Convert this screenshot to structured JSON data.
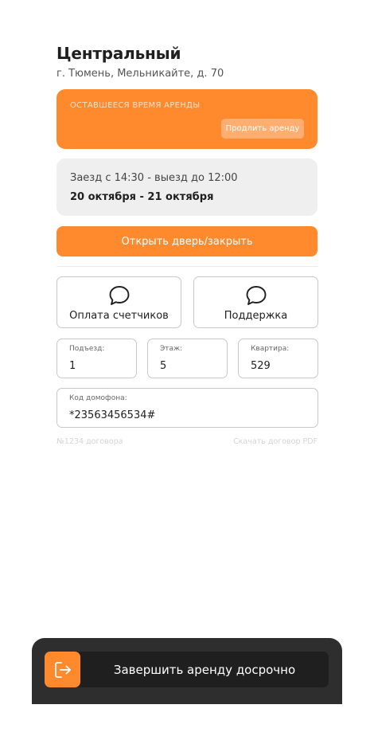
{
  "header": {
    "title": "Центральный",
    "address": "г. Тюмень, Мельникайте, д. 70"
  },
  "rent": {
    "caption": "ОСТАВШЕЕСЯ ВРЕМЯ АРЕНДЫ",
    "extend_label": "Продлить аренду"
  },
  "dates": {
    "checkin_checkout": "Заезд с 14:30 - выезд до 12:00",
    "range": "20 октября - 21 октября"
  },
  "door_button_label": "Открыть дверь/закрыть",
  "actions": {
    "meters": {
      "label": "Оплата счетчиков",
      "icon": "chat-bubble-icon"
    },
    "support": {
      "label": "Поддержка",
      "icon": "chat-bubble-icon"
    }
  },
  "fields": {
    "entrance": {
      "label": "Подъезд:",
      "value": "1"
    },
    "floor": {
      "label": "Этаж:",
      "value": "5"
    },
    "apartment": {
      "label": "Квартира:",
      "value": "529"
    },
    "intercom": {
      "label": "Код домофона:",
      "value": "*23563456534#"
    }
  },
  "footer": {
    "contract_number": "№1234 договора",
    "download_pdf": "Скачать договор PDF"
  },
  "end_rent": {
    "label": "Завершить аренду досрочно",
    "icon": "logout-icon"
  },
  "colors": {
    "accent": "#ff8a2e",
    "bottom_bar": "#2e2e2e",
    "card_grey": "#efefef"
  }
}
